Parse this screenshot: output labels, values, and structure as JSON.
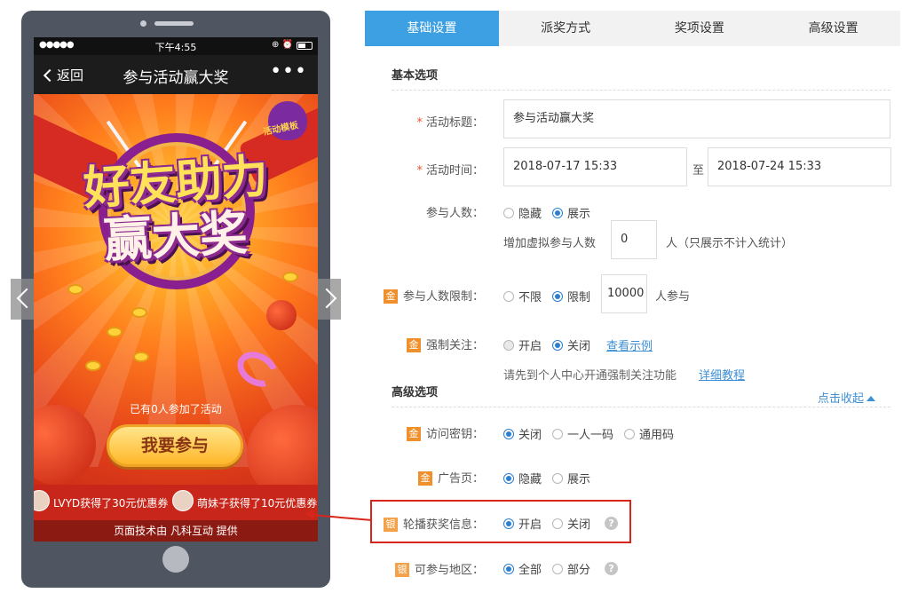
{
  "phone": {
    "status": {
      "signal": "●●●●●",
      "time": "下午4:55",
      "icons": "⊕ ⏰"
    },
    "nav": {
      "back_label": "返回",
      "title": "参与活动赢大奖",
      "more": "•••"
    },
    "poster": {
      "badge_text": "活动模板",
      "title_line1": "好友助力",
      "title_line2": "赢大奖",
      "joined_text": "已有0人参加了活动",
      "join_button": "我要参与"
    },
    "carousel": [
      {
        "text": "LVYD获得了30元优惠券"
      },
      {
        "text": "萌妹子获得了10元优惠券"
      }
    ],
    "footer_credit": "页面技术由 凡科互动 提供"
  },
  "tabs": [
    {
      "label": "基础设置",
      "active": true
    },
    {
      "label": "派奖方式",
      "active": false
    },
    {
      "label": "奖项设置",
      "active": false
    },
    {
      "label": "高级设置",
      "active": false
    }
  ],
  "basic": {
    "section_title": "基本选项",
    "title_label": "活动标题：",
    "title_value": "参与活动赢大奖",
    "time_label": "活动时间：",
    "start_time": "2018-07-17 15:33",
    "to_label": "至",
    "end_time": "2018-07-24 15:33",
    "count_label": "参与人数：",
    "count_options": [
      "隐藏",
      "展示"
    ],
    "virtual_label": "增加虚拟参与人数",
    "virtual_value": "0",
    "virtual_note": "人（只展示不计入统计）",
    "limit_tag": "金",
    "limit_label": "参与人数限制：",
    "limit_options": [
      "不限",
      "限制"
    ],
    "limit_value": "10000",
    "limit_unit": "人参与",
    "follow_tag": "金",
    "follow_label": "强制关注：",
    "follow_options": [
      "开启",
      "关闭"
    ],
    "follow_example_link": "查看示例",
    "follow_hint": "请先到个人中心开通强制关注功能",
    "follow_tutorial_link": "详细教程"
  },
  "advanced": {
    "section_title": "高级选项",
    "collapse_link": "点击收起",
    "password_tag": "金",
    "password_label": "访问密钥：",
    "password_options": [
      "关闭",
      "一人一码",
      "通用码"
    ],
    "ad_tag": "金",
    "ad_label": "广告页：",
    "ad_options": [
      "隐藏",
      "展示"
    ],
    "carousel_tag": "银",
    "carousel_label": "轮播获奖信息：",
    "carousel_options": [
      "开启",
      "关闭"
    ],
    "region_tag": "银",
    "region_label": "可参与地区：",
    "region_options": [
      "全部",
      "部分"
    ],
    "help_glyph": "?"
  },
  "colors": {
    "accent": "#3da0e3",
    "link": "#3d8fd6",
    "gold_tag": "#f0902c",
    "highlight": "#d9261c"
  }
}
